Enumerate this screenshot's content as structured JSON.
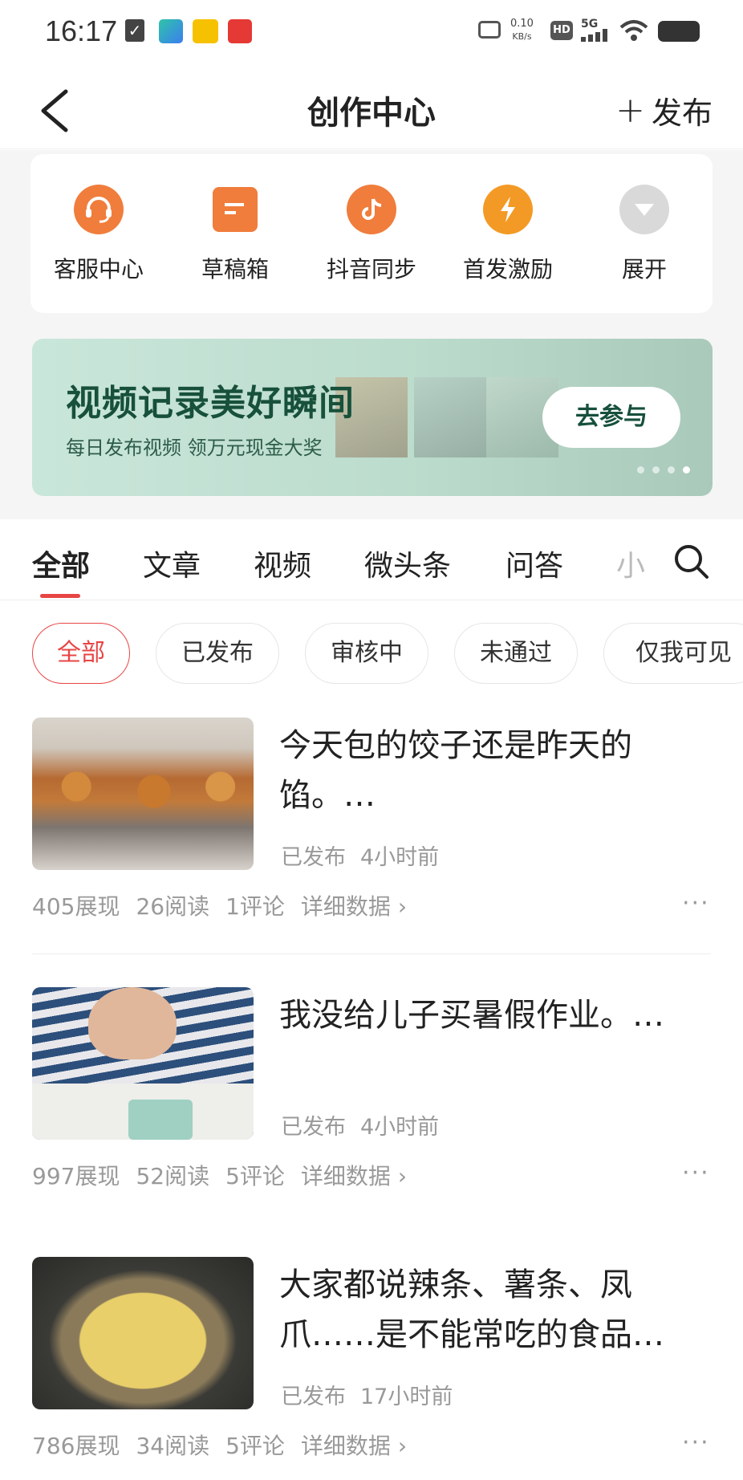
{
  "status_bar": {
    "time": "16:17",
    "app_icons": [
      "check-icon",
      "video-app-icon",
      "meituan-icon",
      "red-app-icon"
    ],
    "net_speed": "0.10",
    "net_speed_unit": "KB/s",
    "hd_label": "HD",
    "network": "5G"
  },
  "header": {
    "title": "创作中心",
    "publish_label": "发布",
    "publish_icon": "plus-icon",
    "back_icon": "chevron-left-icon"
  },
  "tools": [
    {
      "label": "客服中心",
      "icon": "headset-icon",
      "color": "#f07d3c"
    },
    {
      "label": "草稿箱",
      "icon": "draft-icon",
      "color": "#f07d3c"
    },
    {
      "label": "抖音同步",
      "icon": "douyin-icon",
      "color": "#f07d3c"
    },
    {
      "label": "首发激励",
      "icon": "lightning-icon",
      "color": "#f39a26"
    },
    {
      "label": "展开",
      "icon": "expand-down-icon",
      "color": "#d9d9d9"
    }
  ],
  "banner": {
    "title": "视频记录美好瞬间",
    "subtitle": "每日发布视频 领万元现金大奖",
    "button": "去参与",
    "dots_count": 4,
    "active_dot": 3
  },
  "tabs": [
    "全部",
    "文章",
    "视频",
    "微头条",
    "问答",
    "小"
  ],
  "active_tab": 0,
  "filters": [
    "全部",
    "已发布",
    "审核中",
    "未通过",
    "仅我可见"
  ],
  "active_filter": 0,
  "posts": [
    {
      "title": "今天包的饺子还是昨天的馅。…",
      "status": "已发布",
      "time": "4小时前",
      "impressions": "405展现",
      "reads": "26阅读",
      "comments": "1评论",
      "detail": "详细数据 ›",
      "more": "···"
    },
    {
      "title": "我没给儿子买暑假作业。…",
      "status": "已发布",
      "time": "4小时前",
      "impressions": "997展现",
      "reads": "52阅读",
      "comments": "5评论",
      "detail": "详细数据 ›",
      "more": "···"
    },
    {
      "title": "大家都说辣条、薯条、凤爪……是不能常吃的食品…",
      "status": "已发布",
      "time": "17小时前",
      "impressions": "786展现",
      "reads": "34阅读",
      "comments": "5评论",
      "detail": "详细数据 ›",
      "more": "···"
    }
  ],
  "colors": {
    "accent_red": "#e84545",
    "tool_orange": "#f07d3c",
    "banner_green": "#17503b"
  }
}
